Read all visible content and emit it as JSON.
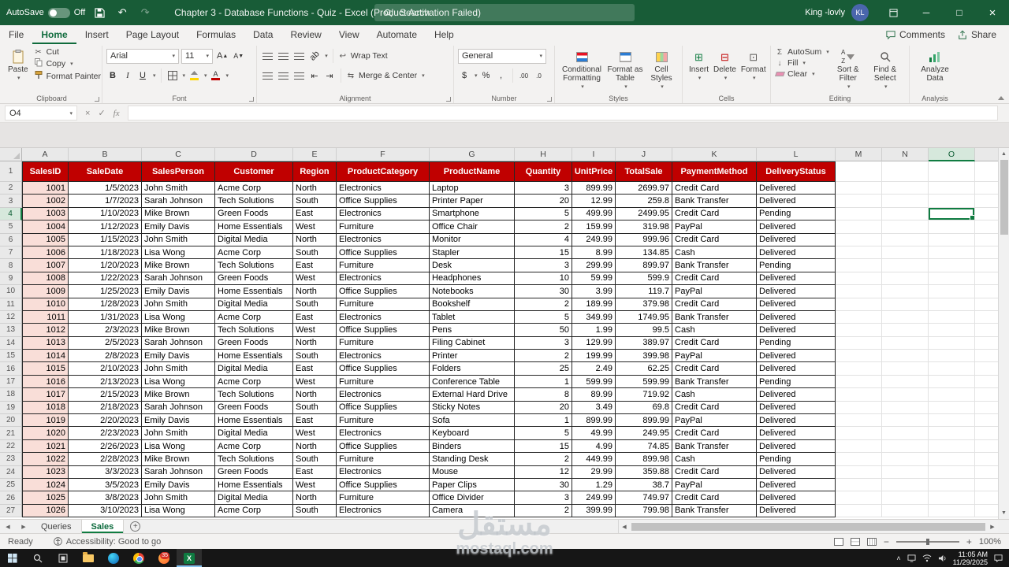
{
  "titlebar": {
    "autosave_label": "AutoSave",
    "autosave_state": "Off",
    "title": "Chapter 3 - Database Functions - Quiz - Excel (Product Activation Failed)",
    "search_placeholder": "Search",
    "user_name": "King -lovly",
    "user_initials": "KL"
  },
  "ribbon": {
    "tabs": [
      "File",
      "Home",
      "Insert",
      "Page Layout",
      "Formulas",
      "Data",
      "Review",
      "View",
      "Automate",
      "Help"
    ],
    "active_tab": "Home",
    "comments_label": "Comments",
    "share_label": "Share",
    "clipboard": {
      "label": "Clipboard",
      "paste": "Paste",
      "cut": "Cut",
      "copy": "Copy",
      "format_painter": "Format Painter"
    },
    "font": {
      "label": "Font",
      "name": "Arial",
      "size": "11"
    },
    "alignment": {
      "label": "Alignment",
      "wrap_text": "Wrap Text",
      "merge_center": "Merge & Center"
    },
    "number": {
      "label": "Number",
      "format": "General",
      "currency": "$",
      "percent": "%",
      "comma": ",",
      "dec_inc": ".00",
      "dec_dec": ".0"
    },
    "styles": {
      "label": "Styles",
      "conditional": "Conditional Formatting",
      "format_table": "Format as Table",
      "cell_styles": "Cell Styles"
    },
    "cells": {
      "label": "Cells",
      "insert": "Insert",
      "delete": "Delete",
      "format": "Format"
    },
    "editing": {
      "label": "Editing",
      "autosum": "AutoSum",
      "fill": "Fill",
      "clear": "Clear",
      "sort_filter": "Sort & Filter",
      "find_select": "Find & Select"
    },
    "analysis": {
      "label": "Analysis",
      "analyze": "Analyze Data"
    }
  },
  "formula_bar": {
    "name_box": "O4",
    "fx": "fx"
  },
  "grid": {
    "columns": [
      "A",
      "B",
      "C",
      "D",
      "E",
      "F",
      "G",
      "H",
      "I",
      "J",
      "K",
      "L",
      "M",
      "N",
      "O"
    ],
    "header_row": [
      "SalesID",
      "SaleDate",
      "SalesPerson",
      "Customer",
      "Region",
      "ProductCategory",
      "ProductName",
      "Quantity",
      "UnitPrice",
      "TotalSale",
      "PaymentMethod",
      "DeliveryStatus"
    ],
    "rows": [
      [
        "1001",
        "1/5/2023",
        "John Smith",
        "Acme Corp",
        "North",
        "Electronics",
        "Laptop",
        "3",
        "899.99",
        "2699.97",
        "Credit Card",
        "Delivered"
      ],
      [
        "1002",
        "1/7/2023",
        "Sarah Johnson",
        "Tech Solutions",
        "South",
        "Office Supplies",
        "Printer Paper",
        "20",
        "12.99",
        "259.8",
        "Bank Transfer",
        "Delivered"
      ],
      [
        "1003",
        "1/10/2023",
        "Mike Brown",
        "Green Foods",
        "East",
        "Electronics",
        "Smartphone",
        "5",
        "499.99",
        "2499.95",
        "Credit Card",
        "Pending"
      ],
      [
        "1004",
        "1/12/2023",
        "Emily Davis",
        "Home Essentials",
        "West",
        "Furniture",
        "Office Chair",
        "2",
        "159.99",
        "319.98",
        "PayPal",
        "Delivered"
      ],
      [
        "1005",
        "1/15/2023",
        "John Smith",
        "Digital Media",
        "North",
        "Electronics",
        "Monitor",
        "4",
        "249.99",
        "999.96",
        "Credit Card",
        "Delivered"
      ],
      [
        "1006",
        "1/18/2023",
        "Lisa Wong",
        "Acme Corp",
        "South",
        "Office Supplies",
        "Stapler",
        "15",
        "8.99",
        "134.85",
        "Cash",
        "Delivered"
      ],
      [
        "1007",
        "1/20/2023",
        "Mike Brown",
        "Tech Solutions",
        "East",
        "Furniture",
        "Desk",
        "3",
        "299.99",
        "899.97",
        "Bank Transfer",
        "Pending"
      ],
      [
        "1008",
        "1/22/2023",
        "Sarah Johnson",
        "Green Foods",
        "West",
        "Electronics",
        "Headphones",
        "10",
        "59.99",
        "599.9",
        "Credit Card",
        "Delivered"
      ],
      [
        "1009",
        "1/25/2023",
        "Emily Davis",
        "Home Essentials",
        "North",
        "Office Supplies",
        "Notebooks",
        "30",
        "3.99",
        "119.7",
        "PayPal",
        "Delivered"
      ],
      [
        "1010",
        "1/28/2023",
        "John Smith",
        "Digital Media",
        "South",
        "Furniture",
        "Bookshelf",
        "2",
        "189.99",
        "379.98",
        "Credit Card",
        "Delivered"
      ],
      [
        "1011",
        "1/31/2023",
        "Lisa Wong",
        "Acme Corp",
        "East",
        "Electronics",
        "Tablet",
        "5",
        "349.99",
        "1749.95",
        "Bank Transfer",
        "Delivered"
      ],
      [
        "1012",
        "2/3/2023",
        "Mike Brown",
        "Tech Solutions",
        "West",
        "Office Supplies",
        "Pens",
        "50",
        "1.99",
        "99.5",
        "Cash",
        "Delivered"
      ],
      [
        "1013",
        "2/5/2023",
        "Sarah Johnson",
        "Green Foods",
        "North",
        "Furniture",
        "Filing Cabinet",
        "3",
        "129.99",
        "389.97",
        "Credit Card",
        "Pending"
      ],
      [
        "1014",
        "2/8/2023",
        "Emily Davis",
        "Home Essentials",
        "South",
        "Electronics",
        "Printer",
        "2",
        "199.99",
        "399.98",
        "PayPal",
        "Delivered"
      ],
      [
        "1015",
        "2/10/2023",
        "John Smith",
        "Digital Media",
        "East",
        "Office Supplies",
        "Folders",
        "25",
        "2.49",
        "62.25",
        "Credit Card",
        "Delivered"
      ],
      [
        "1016",
        "2/13/2023",
        "Lisa Wong",
        "Acme Corp",
        "West",
        "Furniture",
        "Conference Table",
        "1",
        "599.99",
        "599.99",
        "Bank Transfer",
        "Pending"
      ],
      [
        "1017",
        "2/15/2023",
        "Mike Brown",
        "Tech Solutions",
        "North",
        "Electronics",
        "External Hard Drive",
        "8",
        "89.99",
        "719.92",
        "Cash",
        "Delivered"
      ],
      [
        "1018",
        "2/18/2023",
        "Sarah Johnson",
        "Green Foods",
        "South",
        "Office Supplies",
        "Sticky Notes",
        "20",
        "3.49",
        "69.8",
        "Credit Card",
        "Delivered"
      ],
      [
        "1019",
        "2/20/2023",
        "Emily Davis",
        "Home Essentials",
        "East",
        "Furniture",
        "Sofa",
        "1",
        "899.99",
        "899.99",
        "PayPal",
        "Delivered"
      ],
      [
        "1020",
        "2/23/2023",
        "John Smith",
        "Digital Media",
        "West",
        "Electronics",
        "Keyboard",
        "5",
        "49.99",
        "249.95",
        "Credit Card",
        "Delivered"
      ],
      [
        "1021",
        "2/26/2023",
        "Lisa Wong",
        "Acme Corp",
        "North",
        "Office Supplies",
        "Binders",
        "15",
        "4.99",
        "74.85",
        "Bank Transfer",
        "Delivered"
      ],
      [
        "1022",
        "2/28/2023",
        "Mike Brown",
        "Tech Solutions",
        "South",
        "Furniture",
        "Standing Desk",
        "2",
        "449.99",
        "899.98",
        "Cash",
        "Pending"
      ],
      [
        "1023",
        "3/3/2023",
        "Sarah Johnson",
        "Green Foods",
        "East",
        "Electronics",
        "Mouse",
        "12",
        "29.99",
        "359.88",
        "Credit Card",
        "Delivered"
      ],
      [
        "1024",
        "3/5/2023",
        "Emily Davis",
        "Home Essentials",
        "West",
        "Office Supplies",
        "Paper Clips",
        "30",
        "1.29",
        "38.7",
        "PayPal",
        "Delivered"
      ],
      [
        "1025",
        "3/8/2023",
        "John Smith",
        "Digital Media",
        "North",
        "Furniture",
        "Office Divider",
        "3",
        "249.99",
        "749.97",
        "Credit Card",
        "Delivered"
      ],
      [
        "1026",
        "3/10/2023",
        "Lisa Wong",
        "Acme Corp",
        "South",
        "Electronics",
        "Camera",
        "2",
        "399.99",
        "799.98",
        "Bank Transfer",
        "Delivered"
      ]
    ],
    "selection": {
      "cell": "O4",
      "row_number": 4,
      "column": "O"
    }
  },
  "sheet_tabs": {
    "tabs": [
      "Queries",
      "Sales"
    ],
    "active": "Sales"
  },
  "status_bar": {
    "ready": "Ready",
    "accessibility": "Accessibility: Good to go",
    "zoom": "100%"
  },
  "taskbar": {
    "time": "11:05 AM",
    "date": "11/29/2025",
    "badge": "35"
  },
  "watermark": {
    "arabic": "مستقل",
    "latin": "mostaql.com"
  }
}
